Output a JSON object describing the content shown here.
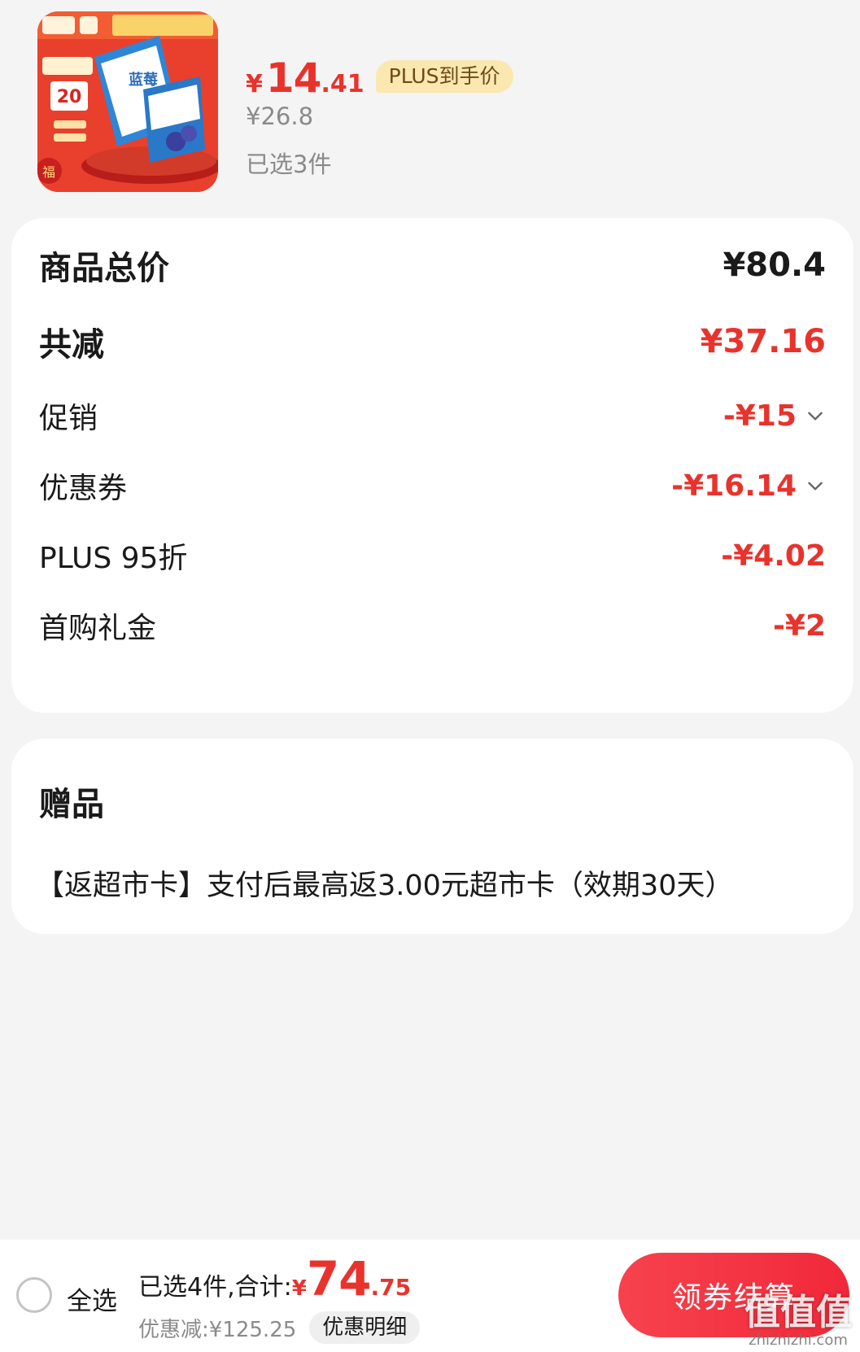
{
  "product": {
    "image_alt": "蓝莓 牛奶饮品 包装",
    "price_currency": "¥",
    "price_integer": "14",
    "price_decimal": ".41",
    "plus_tag": "PLUS到手价",
    "original_price": "¥26.8",
    "selected_count": "已选3件"
  },
  "summary": {
    "rows": [
      {
        "label": "商品总价",
        "value": "¥80.4"
      },
      {
        "label": "共减",
        "value": "¥37.16"
      },
      {
        "label": "促销",
        "value": "-¥15"
      },
      {
        "label": "优惠券",
        "value": "-¥16.14"
      },
      {
        "label": "PLUS 95折",
        "value": "-¥4.02"
      },
      {
        "label": "首购礼金",
        "value": "-¥2"
      }
    ]
  },
  "gift": {
    "title": "赠品",
    "text": "【返超市卡】支付后最高返3.00元超市卡（效期30天）"
  },
  "bottom_bar": {
    "select_all": "全选",
    "total_label": "已选4件,合计:",
    "total_currency": "¥",
    "total_integer": "74",
    "total_decimal": ".75",
    "discount_text": "优惠减:¥125.25",
    "detail_button": "优惠明细",
    "checkout_button": "领券结算",
    "watermark_logo": "值值值",
    "watermark_url": "zhizhizhi.com"
  },
  "colors": {
    "accent_red": "#e8332d",
    "plus_tag_bg": "#fbe7b0",
    "page_bg": "#f4f4f4"
  }
}
